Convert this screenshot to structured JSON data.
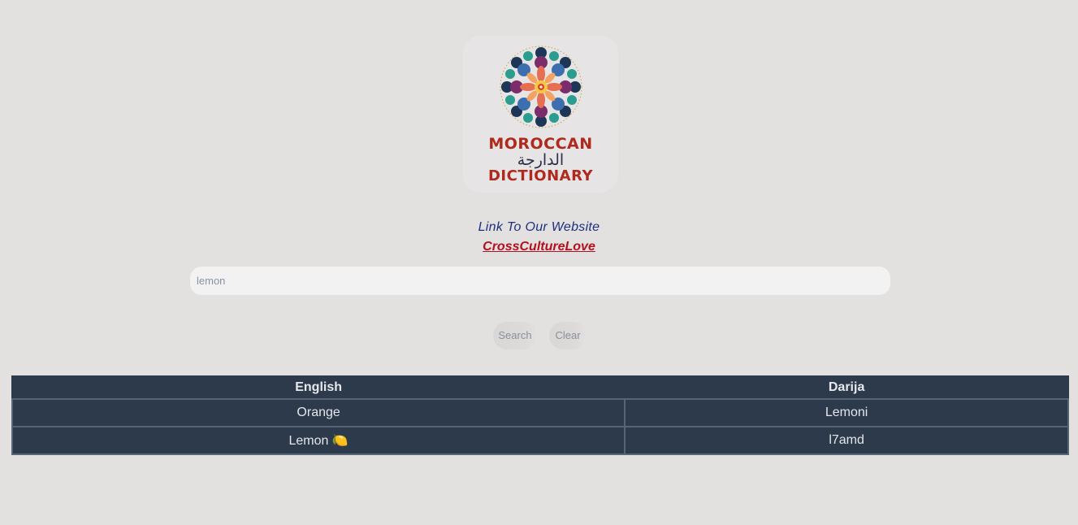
{
  "logo": {
    "word_top": "MOROCCAN",
    "word_arabic": "الدارجة",
    "word_bottom": "DICTIONARY"
  },
  "links": {
    "title": "Link To Our Website",
    "site": "CrossCultureLove"
  },
  "search": {
    "placeholder": "lemon",
    "value": ""
  },
  "buttons": {
    "search_label": "Search",
    "clear_label": "Clear"
  },
  "table": {
    "columns": [
      "English",
      "Darija"
    ],
    "rows": [
      [
        "Orange",
        "Lemoni"
      ],
      [
        "Lemon 🍋",
        "l7amd"
      ]
    ]
  },
  "colors": {
    "background": "#e2e1e0",
    "table_bg": "#2d3a4c",
    "link_title": "#1f2f7c",
    "link_site": "#b5101e",
    "logo_red": "#b0291d"
  }
}
